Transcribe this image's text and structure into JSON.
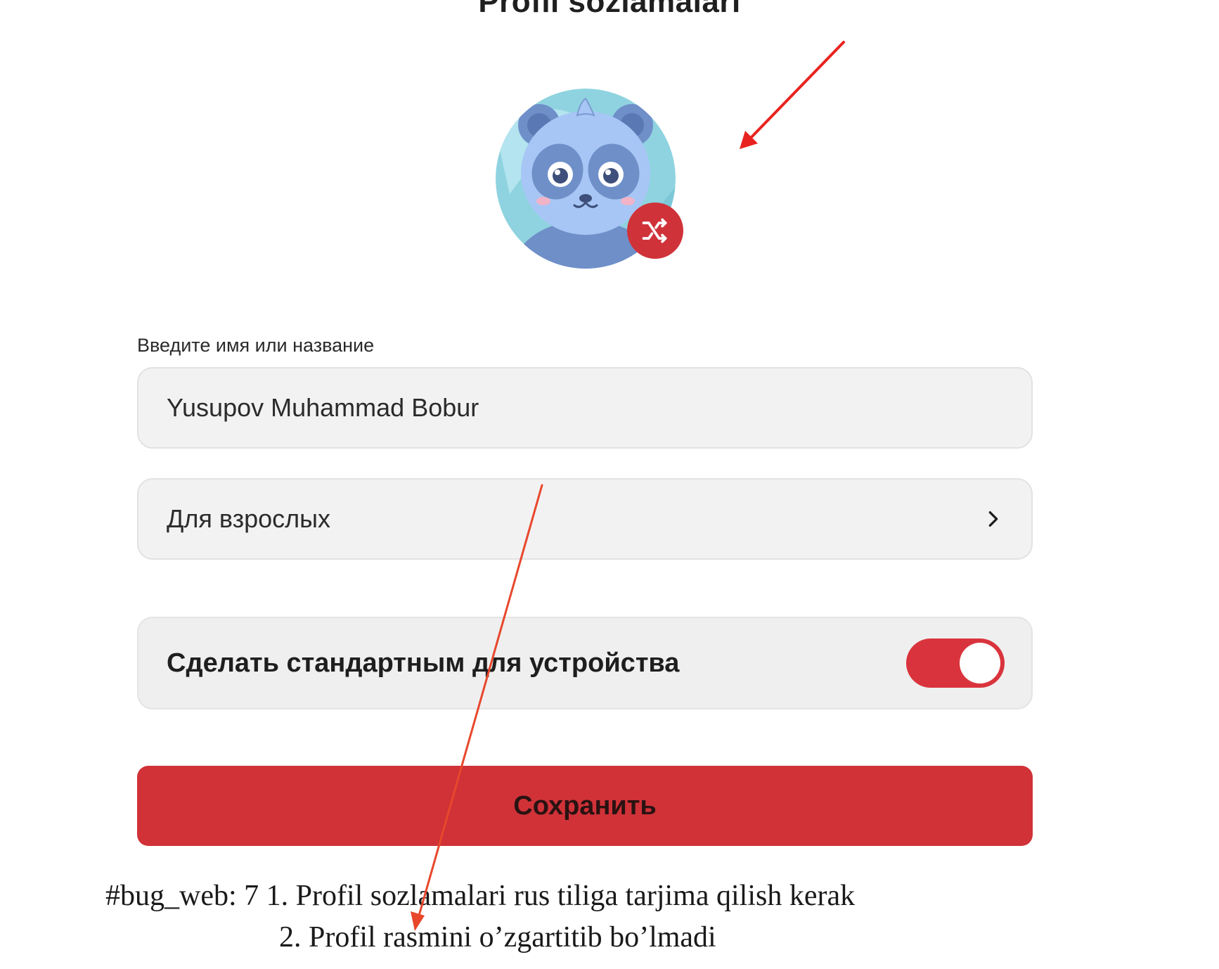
{
  "page": {
    "title": "Profil sozlamalari"
  },
  "avatar": {
    "icon": "panda-avatar",
    "shuffle_icon": "shuffle-icon",
    "shuffle_color": "#d0323a"
  },
  "name_field": {
    "label": "Введите имя или название",
    "value": "Yusupov Muhammad Bobur"
  },
  "age_select": {
    "value": "Для взрослых",
    "icon": "chevron-right-icon"
  },
  "default_toggle": {
    "label": "Сделать стандартным для устройства",
    "checked": true,
    "color": "#d9343d"
  },
  "save_button": {
    "label": "Сохранить",
    "color": "#d03238"
  },
  "annotations": {
    "line1": "#bug_web: 7 1. Profil sozlamalari rus tiliga tarjima qilish kerak",
    "line2": "2. Profil rasmini o’zgartitib bo’lmadi",
    "arrow_color": "#e8231f"
  }
}
